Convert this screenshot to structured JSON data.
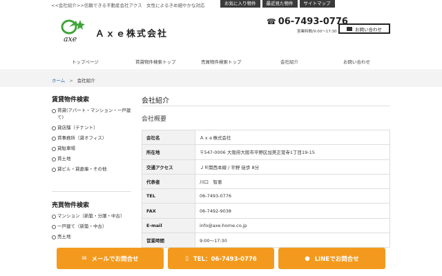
{
  "header": {
    "tagline": "<<会社紹介>>信頼できる不動産会社アクス　女性によるきめ細やかな対応",
    "top_links": [
      "お気に入り物件",
      "最近見た物件",
      "サイトマップ"
    ],
    "logo_text": "axe",
    "company_name": "Ａｘｅ株式会社",
    "phone": "06-7493-0776",
    "hours": "営業時間/9:00〜17:30",
    "contact_button": "お問い合わせ"
  },
  "nav": [
    "トップページ",
    "賃貸物件検索トップ",
    "売買物件検索トップ",
    "会社紹介",
    "お問い合わせ"
  ],
  "breadcrumb": {
    "home": "ホーム",
    "separator": ">",
    "current": "会社紹介"
  },
  "sidebar": {
    "rental": {
      "heading": "賃貸物件検索",
      "items": [
        "賃貸(アパート・マンション・一戸建て)",
        "貸店舗（テナント）",
        "賃事務所（貸オフィス）",
        "貸駐車場",
        "賃土地",
        "貸ビル・貸倉庫・その他"
      ]
    },
    "sale": {
      "heading": "売買物件検索",
      "items": [
        "マンション（新築・分譲・中古）",
        "一戸建て（新築・中古）",
        "売土地"
      ]
    }
  },
  "main": {
    "title": "会社紹介",
    "subtitle": "会社概要",
    "table": [
      {
        "k": "会社名",
        "v": "Ａｘｅ株式会社"
      },
      {
        "k": "所在地",
        "v": "〒547-0006 大阪府大阪市平野区加美正覚寺1丁目19-15"
      },
      {
        "k": "交通アクセス",
        "v": "ＪＲ関西本線 / 平野 徒歩 8分"
      },
      {
        "k": "代表者",
        "v": "川口　智恵"
      },
      {
        "k": "TEL",
        "v": "06-7493-0776"
      },
      {
        "k": "FAX",
        "v": "06-7492-9038"
      },
      {
        "k": "E-mail",
        "v": "info@axe-home.co.jp"
      },
      {
        "k": "営業時間",
        "v": "9:00〜17:30"
      }
    ]
  },
  "cta": {
    "mail": "メールでお問合せ",
    "tel": "TEL：06-7493-0776",
    "line": "LINEでお問合せ"
  },
  "colors": {
    "accent": "#f39a1e",
    "logo_green": "#3fa43a",
    "dark": "#3a3a3a"
  }
}
